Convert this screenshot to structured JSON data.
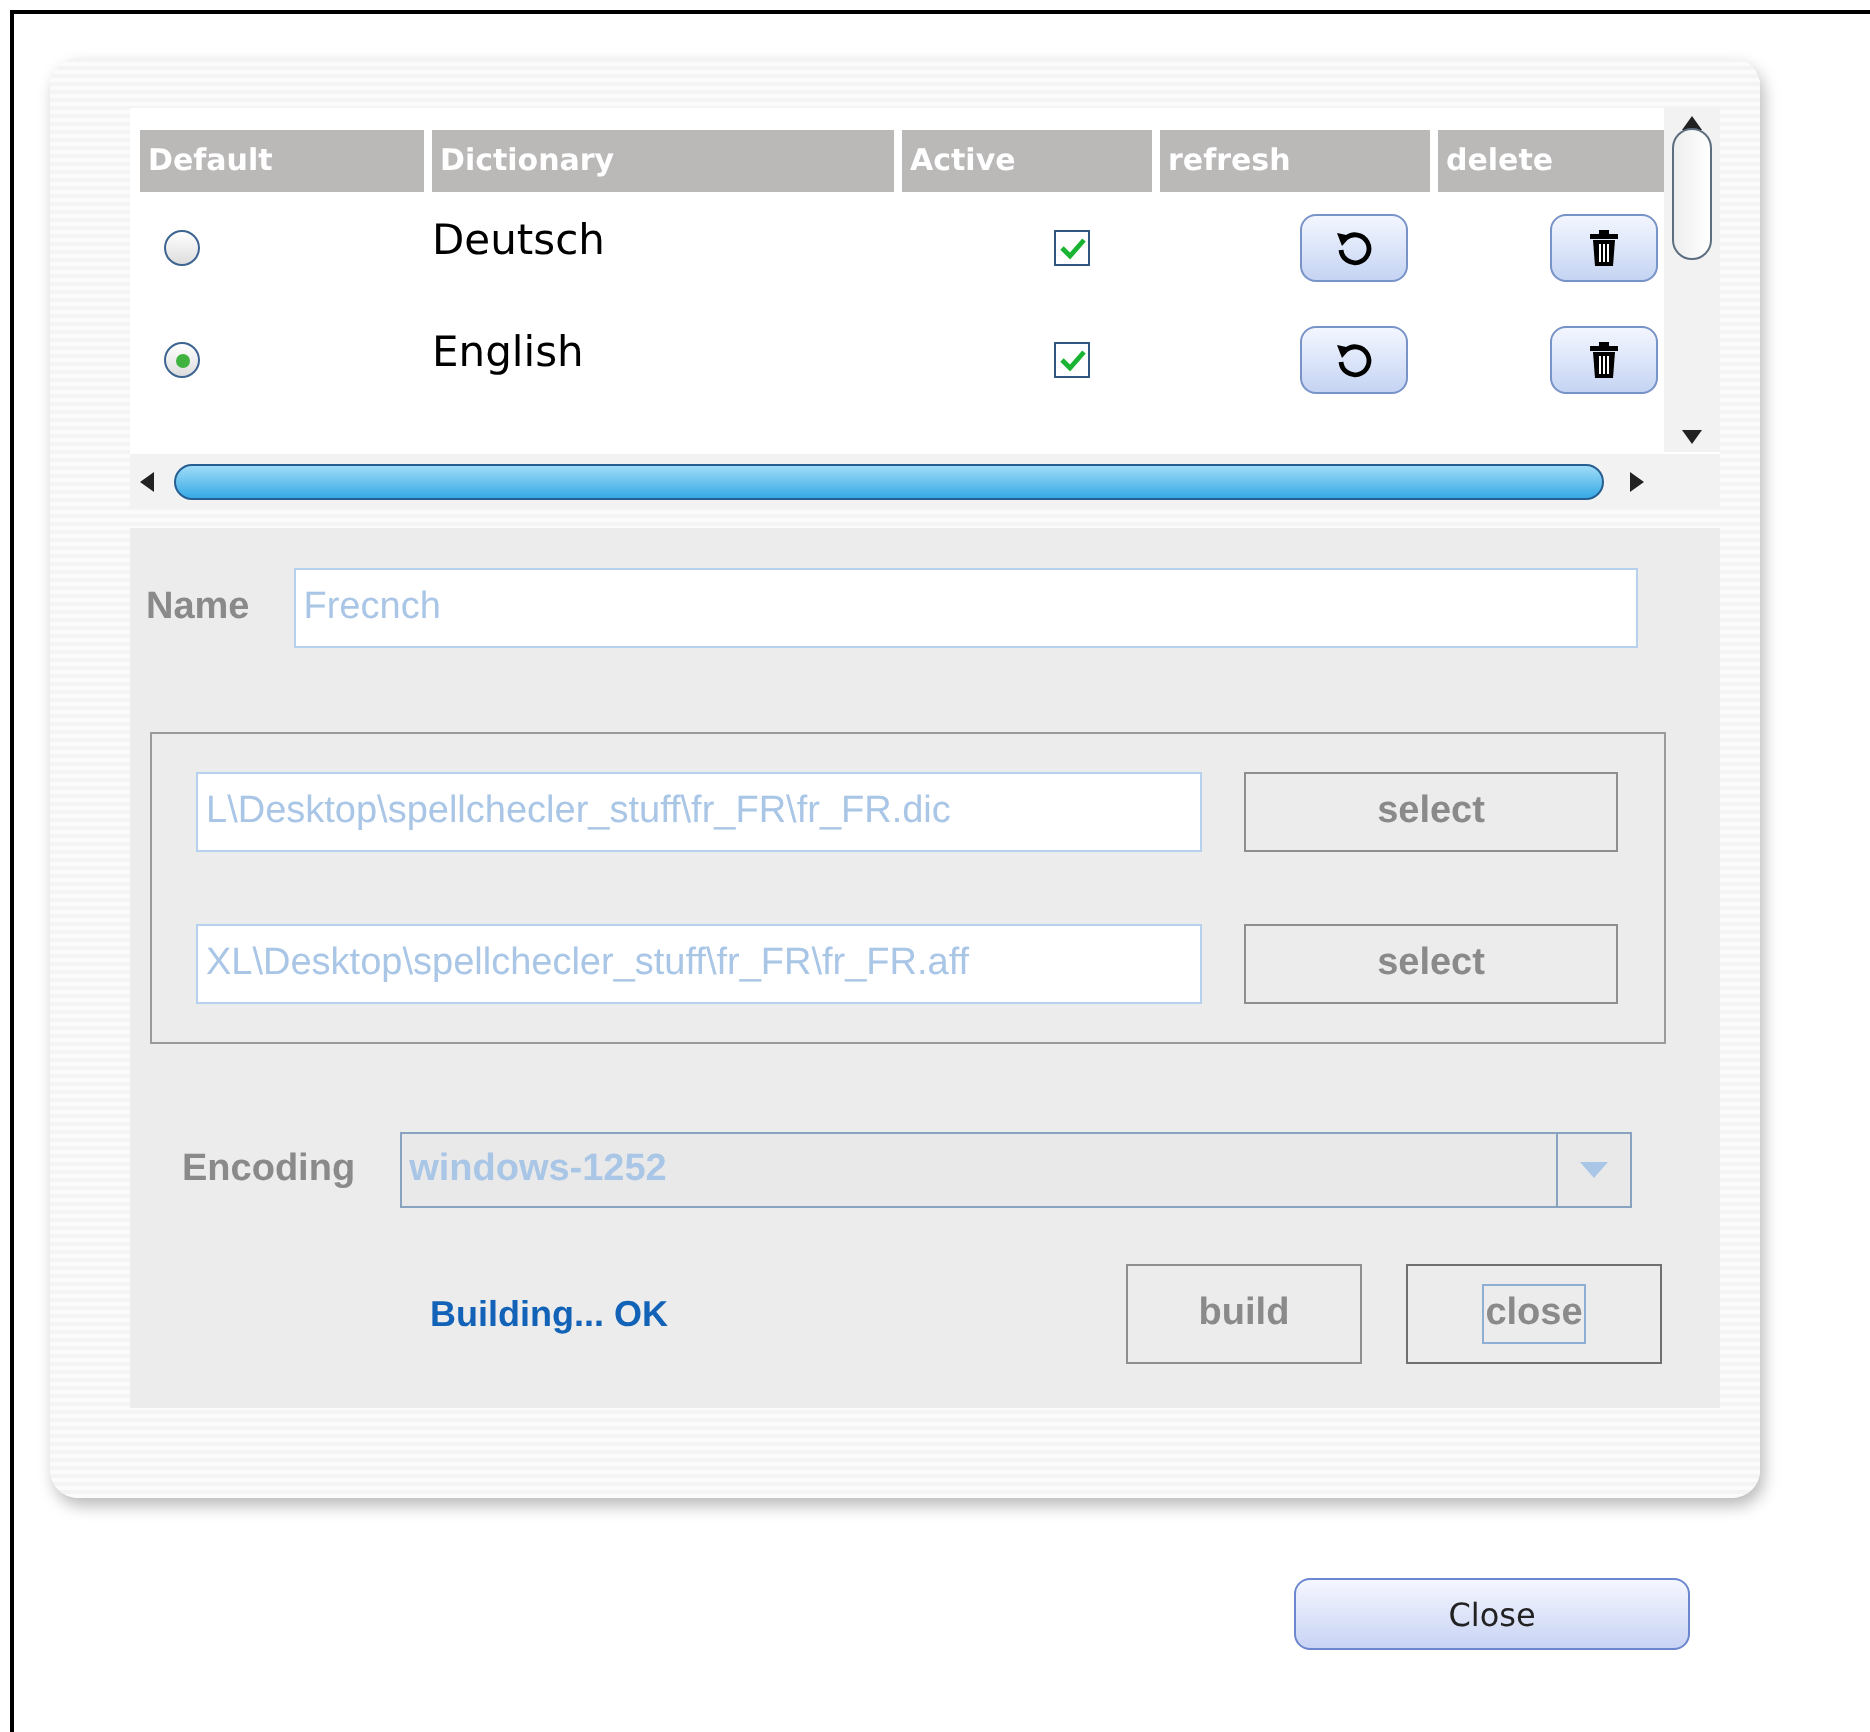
{
  "table": {
    "columns": [
      "Default",
      "Dictionary",
      "Active",
      "refresh",
      "delete"
    ],
    "rows": [
      {
        "name": "Deutsch",
        "selected": false,
        "active": true
      },
      {
        "name": "English",
        "selected": true,
        "active": true
      }
    ]
  },
  "form": {
    "name_label": "Name",
    "name_value": "Frecnch",
    "files": [
      {
        "path": "L\\Desktop\\spellchecler_stuff\\fr_FR\\fr_FR.dic",
        "button": "select"
      },
      {
        "path": "XL\\Desktop\\spellchecler_stuff\\fr_FR\\fr_FR.aff",
        "button": "select"
      }
    ],
    "encoding_label": "Encoding",
    "encoding_value": "windows-1252",
    "status": "Building... OK",
    "buttons": [
      {
        "label": "build",
        "focused": false
      },
      {
        "label": "close",
        "focused": true
      }
    ]
  },
  "footer": {
    "button": "Close"
  }
}
